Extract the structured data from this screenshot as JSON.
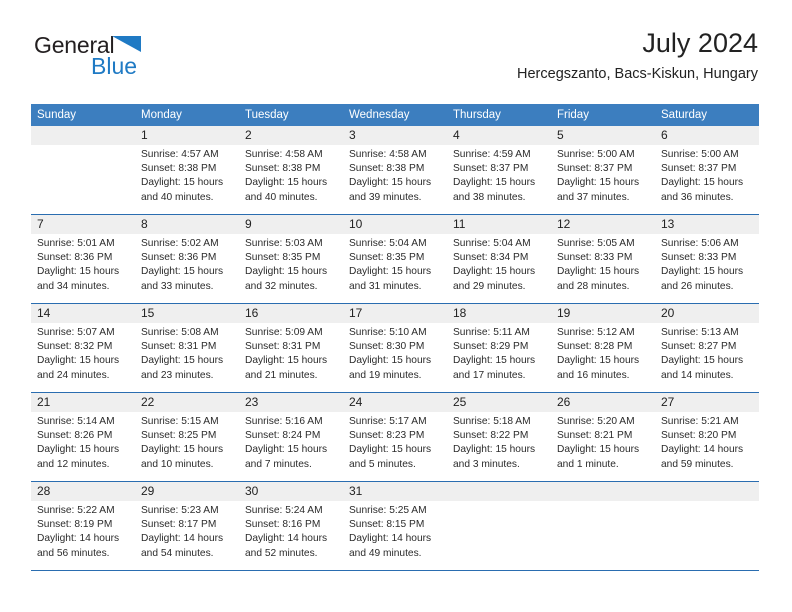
{
  "logo": {
    "word_general": "General",
    "word_blue": "Blue",
    "triangle_color": "#1f7ac4",
    "general_color": "#231f20",
    "blue_color": "#1f7ac4"
  },
  "header": {
    "title": "July 2024",
    "subtitle": "Hercegszanto, Bacs-Kiskun, Hungary"
  },
  "theme": {
    "header_row_bg": "#3c7ebf",
    "header_row_text": "#ffffff",
    "week_separator": "#2a6db0",
    "daynum_band_bg": "#efefef",
    "cell_bg": "#ffffff",
    "text": "#2b2b2b"
  },
  "weekdays": [
    "Sunday",
    "Monday",
    "Tuesday",
    "Wednesday",
    "Thursday",
    "Friday",
    "Saturday"
  ],
  "weeks": [
    [
      {
        "day": "",
        "sunrise": "",
        "sunset": "",
        "daylight_line1": "",
        "daylight_line2": "",
        "empty": true
      },
      {
        "day": "1",
        "sunrise": "Sunrise: 4:57 AM",
        "sunset": "Sunset: 8:38 PM",
        "daylight_line1": "Daylight: 15 hours",
        "daylight_line2": "and 40 minutes.",
        "empty": false
      },
      {
        "day": "2",
        "sunrise": "Sunrise: 4:58 AM",
        "sunset": "Sunset: 8:38 PM",
        "daylight_line1": "Daylight: 15 hours",
        "daylight_line2": "and 40 minutes.",
        "empty": false
      },
      {
        "day": "3",
        "sunrise": "Sunrise: 4:58 AM",
        "sunset": "Sunset: 8:38 PM",
        "daylight_line1": "Daylight: 15 hours",
        "daylight_line2": "and 39 minutes.",
        "empty": false
      },
      {
        "day": "4",
        "sunrise": "Sunrise: 4:59 AM",
        "sunset": "Sunset: 8:37 PM",
        "daylight_line1": "Daylight: 15 hours",
        "daylight_line2": "and 38 minutes.",
        "empty": false
      },
      {
        "day": "5",
        "sunrise": "Sunrise: 5:00 AM",
        "sunset": "Sunset: 8:37 PM",
        "daylight_line1": "Daylight: 15 hours",
        "daylight_line2": "and 37 minutes.",
        "empty": false
      },
      {
        "day": "6",
        "sunrise": "Sunrise: 5:00 AM",
        "sunset": "Sunset: 8:37 PM",
        "daylight_line1": "Daylight: 15 hours",
        "daylight_line2": "and 36 minutes.",
        "empty": false
      }
    ],
    [
      {
        "day": "7",
        "sunrise": "Sunrise: 5:01 AM",
        "sunset": "Sunset: 8:36 PM",
        "daylight_line1": "Daylight: 15 hours",
        "daylight_line2": "and 34 minutes.",
        "empty": false
      },
      {
        "day": "8",
        "sunrise": "Sunrise: 5:02 AM",
        "sunset": "Sunset: 8:36 PM",
        "daylight_line1": "Daylight: 15 hours",
        "daylight_line2": "and 33 minutes.",
        "empty": false
      },
      {
        "day": "9",
        "sunrise": "Sunrise: 5:03 AM",
        "sunset": "Sunset: 8:35 PM",
        "daylight_line1": "Daylight: 15 hours",
        "daylight_line2": "and 32 minutes.",
        "empty": false
      },
      {
        "day": "10",
        "sunrise": "Sunrise: 5:04 AM",
        "sunset": "Sunset: 8:35 PM",
        "daylight_line1": "Daylight: 15 hours",
        "daylight_line2": "and 31 minutes.",
        "empty": false
      },
      {
        "day": "11",
        "sunrise": "Sunrise: 5:04 AM",
        "sunset": "Sunset: 8:34 PM",
        "daylight_line1": "Daylight: 15 hours",
        "daylight_line2": "and 29 minutes.",
        "empty": false
      },
      {
        "day": "12",
        "sunrise": "Sunrise: 5:05 AM",
        "sunset": "Sunset: 8:33 PM",
        "daylight_line1": "Daylight: 15 hours",
        "daylight_line2": "and 28 minutes.",
        "empty": false
      },
      {
        "day": "13",
        "sunrise": "Sunrise: 5:06 AM",
        "sunset": "Sunset: 8:33 PM",
        "daylight_line1": "Daylight: 15 hours",
        "daylight_line2": "and 26 minutes.",
        "empty": false
      }
    ],
    [
      {
        "day": "14",
        "sunrise": "Sunrise: 5:07 AM",
        "sunset": "Sunset: 8:32 PM",
        "daylight_line1": "Daylight: 15 hours",
        "daylight_line2": "and 24 minutes.",
        "empty": false
      },
      {
        "day": "15",
        "sunrise": "Sunrise: 5:08 AM",
        "sunset": "Sunset: 8:31 PM",
        "daylight_line1": "Daylight: 15 hours",
        "daylight_line2": "and 23 minutes.",
        "empty": false
      },
      {
        "day": "16",
        "sunrise": "Sunrise: 5:09 AM",
        "sunset": "Sunset: 8:31 PM",
        "daylight_line1": "Daylight: 15 hours",
        "daylight_line2": "and 21 minutes.",
        "empty": false
      },
      {
        "day": "17",
        "sunrise": "Sunrise: 5:10 AM",
        "sunset": "Sunset: 8:30 PM",
        "daylight_line1": "Daylight: 15 hours",
        "daylight_line2": "and 19 minutes.",
        "empty": false
      },
      {
        "day": "18",
        "sunrise": "Sunrise: 5:11 AM",
        "sunset": "Sunset: 8:29 PM",
        "daylight_line1": "Daylight: 15 hours",
        "daylight_line2": "and 17 minutes.",
        "empty": false
      },
      {
        "day": "19",
        "sunrise": "Sunrise: 5:12 AM",
        "sunset": "Sunset: 8:28 PM",
        "daylight_line1": "Daylight: 15 hours",
        "daylight_line2": "and 16 minutes.",
        "empty": false
      },
      {
        "day": "20",
        "sunrise": "Sunrise: 5:13 AM",
        "sunset": "Sunset: 8:27 PM",
        "daylight_line1": "Daylight: 15 hours",
        "daylight_line2": "and 14 minutes.",
        "empty": false
      }
    ],
    [
      {
        "day": "21",
        "sunrise": "Sunrise: 5:14 AM",
        "sunset": "Sunset: 8:26 PM",
        "daylight_line1": "Daylight: 15 hours",
        "daylight_line2": "and 12 minutes.",
        "empty": false
      },
      {
        "day": "22",
        "sunrise": "Sunrise: 5:15 AM",
        "sunset": "Sunset: 8:25 PM",
        "daylight_line1": "Daylight: 15 hours",
        "daylight_line2": "and 10 minutes.",
        "empty": false
      },
      {
        "day": "23",
        "sunrise": "Sunrise: 5:16 AM",
        "sunset": "Sunset: 8:24 PM",
        "daylight_line1": "Daylight: 15 hours",
        "daylight_line2": "and 7 minutes.",
        "empty": false
      },
      {
        "day": "24",
        "sunrise": "Sunrise: 5:17 AM",
        "sunset": "Sunset: 8:23 PM",
        "daylight_line1": "Daylight: 15 hours",
        "daylight_line2": "and 5 minutes.",
        "empty": false
      },
      {
        "day": "25",
        "sunrise": "Sunrise: 5:18 AM",
        "sunset": "Sunset: 8:22 PM",
        "daylight_line1": "Daylight: 15 hours",
        "daylight_line2": "and 3 minutes.",
        "empty": false
      },
      {
        "day": "26",
        "sunrise": "Sunrise: 5:20 AM",
        "sunset": "Sunset: 8:21 PM",
        "daylight_line1": "Daylight: 15 hours",
        "daylight_line2": "and 1 minute.",
        "empty": false
      },
      {
        "day": "27",
        "sunrise": "Sunrise: 5:21 AM",
        "sunset": "Sunset: 8:20 PM",
        "daylight_line1": "Daylight: 14 hours",
        "daylight_line2": "and 59 minutes.",
        "empty": false
      }
    ],
    [
      {
        "day": "28",
        "sunrise": "Sunrise: 5:22 AM",
        "sunset": "Sunset: 8:19 PM",
        "daylight_line1": "Daylight: 14 hours",
        "daylight_line2": "and 56 minutes.",
        "empty": false
      },
      {
        "day": "29",
        "sunrise": "Sunrise: 5:23 AM",
        "sunset": "Sunset: 8:17 PM",
        "daylight_line1": "Daylight: 14 hours",
        "daylight_line2": "and 54 minutes.",
        "empty": false
      },
      {
        "day": "30",
        "sunrise": "Sunrise: 5:24 AM",
        "sunset": "Sunset: 8:16 PM",
        "daylight_line1": "Daylight: 14 hours",
        "daylight_line2": "and 52 minutes.",
        "empty": false
      },
      {
        "day": "31",
        "sunrise": "Sunrise: 5:25 AM",
        "sunset": "Sunset: 8:15 PM",
        "daylight_line1": "Daylight: 14 hours",
        "daylight_line2": "and 49 minutes.",
        "empty": false
      },
      {
        "day": "",
        "sunrise": "",
        "sunset": "",
        "daylight_line1": "",
        "daylight_line2": "",
        "empty": true
      },
      {
        "day": "",
        "sunrise": "",
        "sunset": "",
        "daylight_line1": "",
        "daylight_line2": "",
        "empty": true
      },
      {
        "day": "",
        "sunrise": "",
        "sunset": "",
        "daylight_line1": "",
        "daylight_line2": "",
        "empty": true
      }
    ]
  ]
}
